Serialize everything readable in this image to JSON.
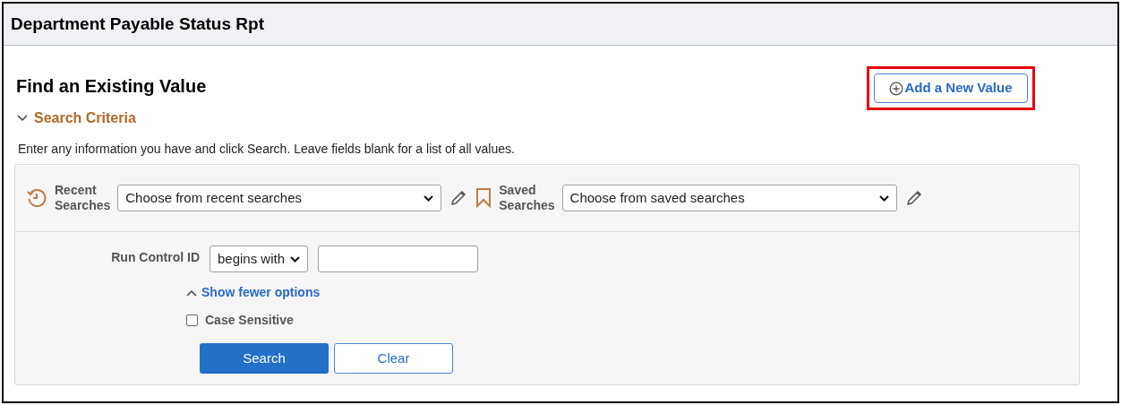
{
  "page_title": "Department Payable Status Rpt",
  "heading": "Find an Existing Value",
  "add_button": {
    "label": "Add a New Value",
    "highlighted": true
  },
  "search_criteria": {
    "label": "Search Criteria",
    "expanded": true
  },
  "instructions": "Enter any information you have and click Search. Leave fields blank for a list of all values.",
  "recent_searches": {
    "label_lines": [
      "Recent",
      "Searches"
    ],
    "value": "Choose from recent searches"
  },
  "saved_searches": {
    "label_lines": [
      "Saved",
      "Searches"
    ],
    "value": "Choose from saved searches"
  },
  "run_control_id": {
    "label": "Run Control ID",
    "operator": "begins with"
  },
  "options_toggle": {
    "label": "Show fewer options",
    "expanded": true
  },
  "case_sensitive": {
    "label": "Case Sensitive",
    "checked": false
  },
  "buttons": [
    {
      "label": "Search",
      "kind": "primary"
    },
    {
      "label": "Clear",
      "kind": "secondary"
    }
  ]
}
